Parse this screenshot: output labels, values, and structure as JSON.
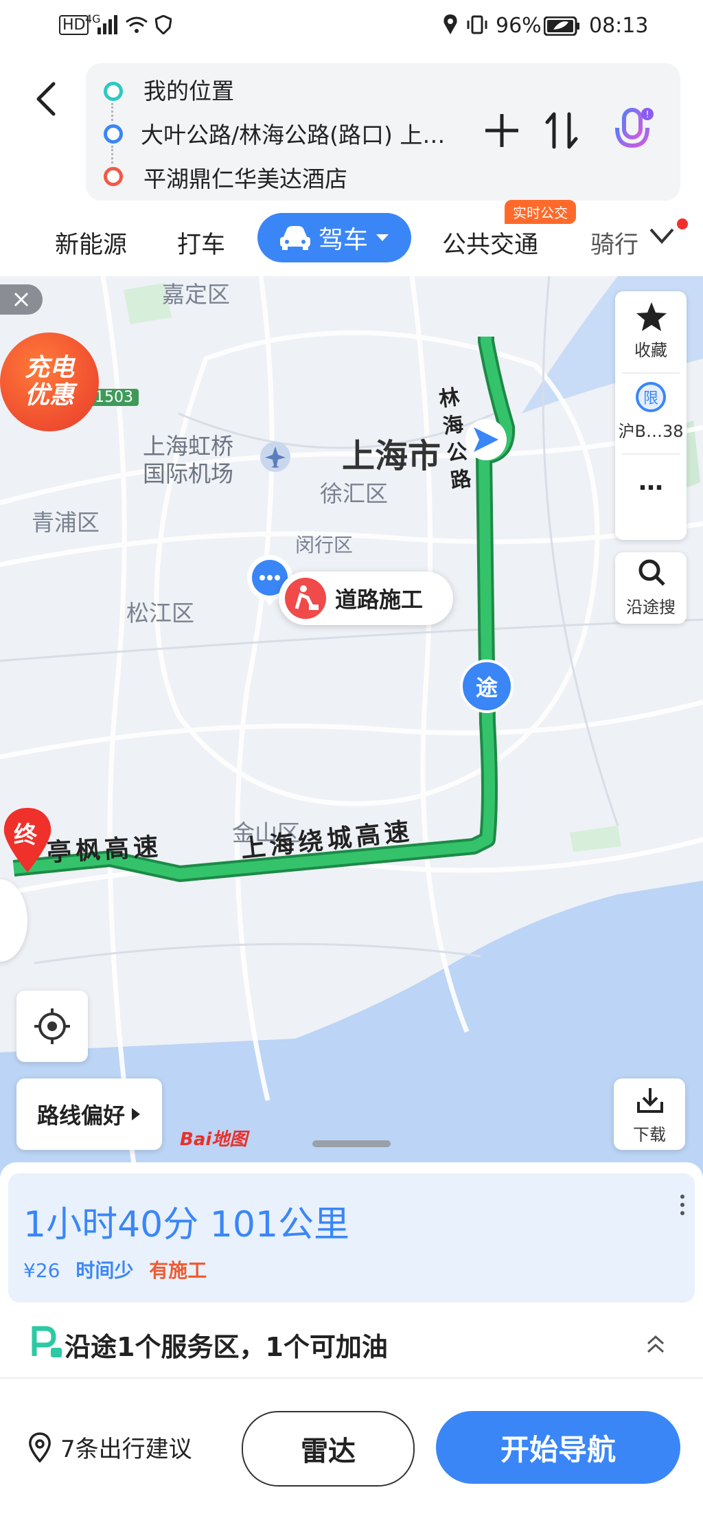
{
  "status_bar": {
    "hd": "HD",
    "signal": "4G",
    "battery": "96%",
    "time": "08:13"
  },
  "route": {
    "origin": "我的位置",
    "waypoint": "大叶公路/林海公路(路口) 上…",
    "destination": "平湖鼎仁华美达酒店"
  },
  "modes": {
    "new_energy": "新能源",
    "taxi": "打车",
    "drive": "驾车",
    "transit": "公共交通",
    "transit_badge": "实时公交",
    "ride": "骑行"
  },
  "map": {
    "places": {
      "jiading": "嘉定区",
      "hongqiao": "上海虹桥\n国际机场",
      "shanghai": "上海市",
      "xuhui": "徐汇区",
      "qingpu": "青浦区",
      "songjiang": "松江区",
      "jinshan": "金山区",
      "minhang": "闵行区"
    },
    "roads": {
      "linhai": "林\n海\n公\n路",
      "ring": "上海绕城高速",
      "tingfeng": "亭枫高速",
      "g1503": "1503"
    },
    "construction_label": "道路施工",
    "waypoint_marker": "途",
    "end_marker": "终",
    "promo": "充电\n优惠",
    "favorite_label": "收藏",
    "restriction_icon_text": "限",
    "restriction_label": "沪B…38",
    "more_label": "…",
    "search_along_label": "沿途搜",
    "route_pref_label": "路线偏好",
    "download_label": "下载",
    "logo": "Bai地图"
  },
  "summary": {
    "eta": "1小时40分 101公里",
    "toll": "¥26",
    "tag_fast": "时间少",
    "tag_construction": "有施工",
    "service": "沿途1个服务区，1个可加油"
  },
  "bottom": {
    "suggestions": "7条出行建议",
    "radar": "雷达",
    "start_nav": "开始导航"
  },
  "colors": {
    "primary": "#3a86f7",
    "route_green": "#23a45a",
    "alert_red": "#f04a4a",
    "badge_orange": "#ff6a2a"
  }
}
